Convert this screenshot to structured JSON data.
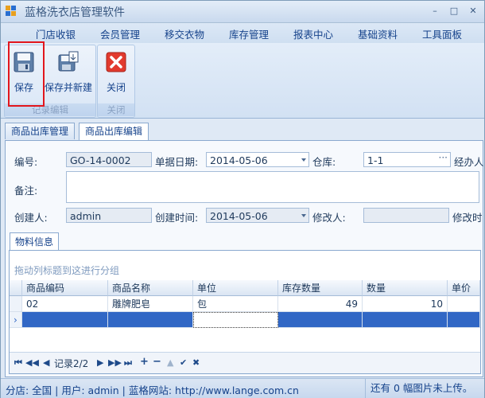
{
  "window": {
    "title": "蓝格洗衣店管理软件",
    "controls": [
      "–",
      "□",
      "✕"
    ]
  },
  "menu": {
    "items": [
      "门店收银",
      "会员管理",
      "移交衣物",
      "库存管理",
      "报表中心",
      "基础资料",
      "工具面板"
    ]
  },
  "ribbon": {
    "groups": [
      {
        "label": "记录编辑",
        "buttons": [
          {
            "label": "保存",
            "icon": "floppy-disk-icon"
          },
          {
            "label": "保存并新建",
            "icon": "save-new-icon"
          }
        ]
      },
      {
        "label": "关闭",
        "buttons": [
          {
            "label": "关闭",
            "icon": "close-red-x-icon"
          }
        ]
      }
    ]
  },
  "tabs": [
    {
      "label": "商品出库管理",
      "active": false
    },
    {
      "label": "商品出库编辑",
      "active": true
    }
  ],
  "form": {
    "code_label": "编号:",
    "code_value": "GO-14-0002",
    "date_label": "单据日期:",
    "date_value": "2014-05-06",
    "warehouse_label": "仓库:",
    "warehouse_value": "1-1",
    "handler_label": "经办人",
    "remark_label": "备注:",
    "remark_value": "",
    "creator_label": "创建人:",
    "creator_value": "admin",
    "created_time_label": "创建时间:",
    "created_time_value": "2014-05-06",
    "modifier_label": "修改人:",
    "modifier_value": "",
    "modified_time_label": "修改时"
  },
  "detail": {
    "tab_label": "物料信息",
    "group_hint": "拖动列标题到这进行分组",
    "columns": [
      "商品编码",
      "商品名称",
      "单位",
      "库存数量",
      "数量",
      "单价"
    ],
    "rows": [
      {
        "code": "02",
        "name": "雕牌肥皂",
        "unit": "包",
        "stock": "49",
        "qty": "10",
        "price": ""
      }
    ],
    "new_row_indicator": "›",
    "nav": {
      "record_text": "记录2/2",
      "buttons": [
        "⏮",
        "◀◀",
        "◀",
        "▶",
        "▶▶",
        "⏭",
        "+",
        "−",
        "▲",
        "✔",
        "✖"
      ]
    }
  },
  "status": {
    "left": "分店: 全国  | 用户: admin  |  蓝格网站: http://www.lange.com.cn",
    "right": "还有 0 幅图片未上传。"
  },
  "colors": {
    "accent": "#15428b",
    "selection": "#3167c5",
    "highlight_box": "#e2161d"
  }
}
